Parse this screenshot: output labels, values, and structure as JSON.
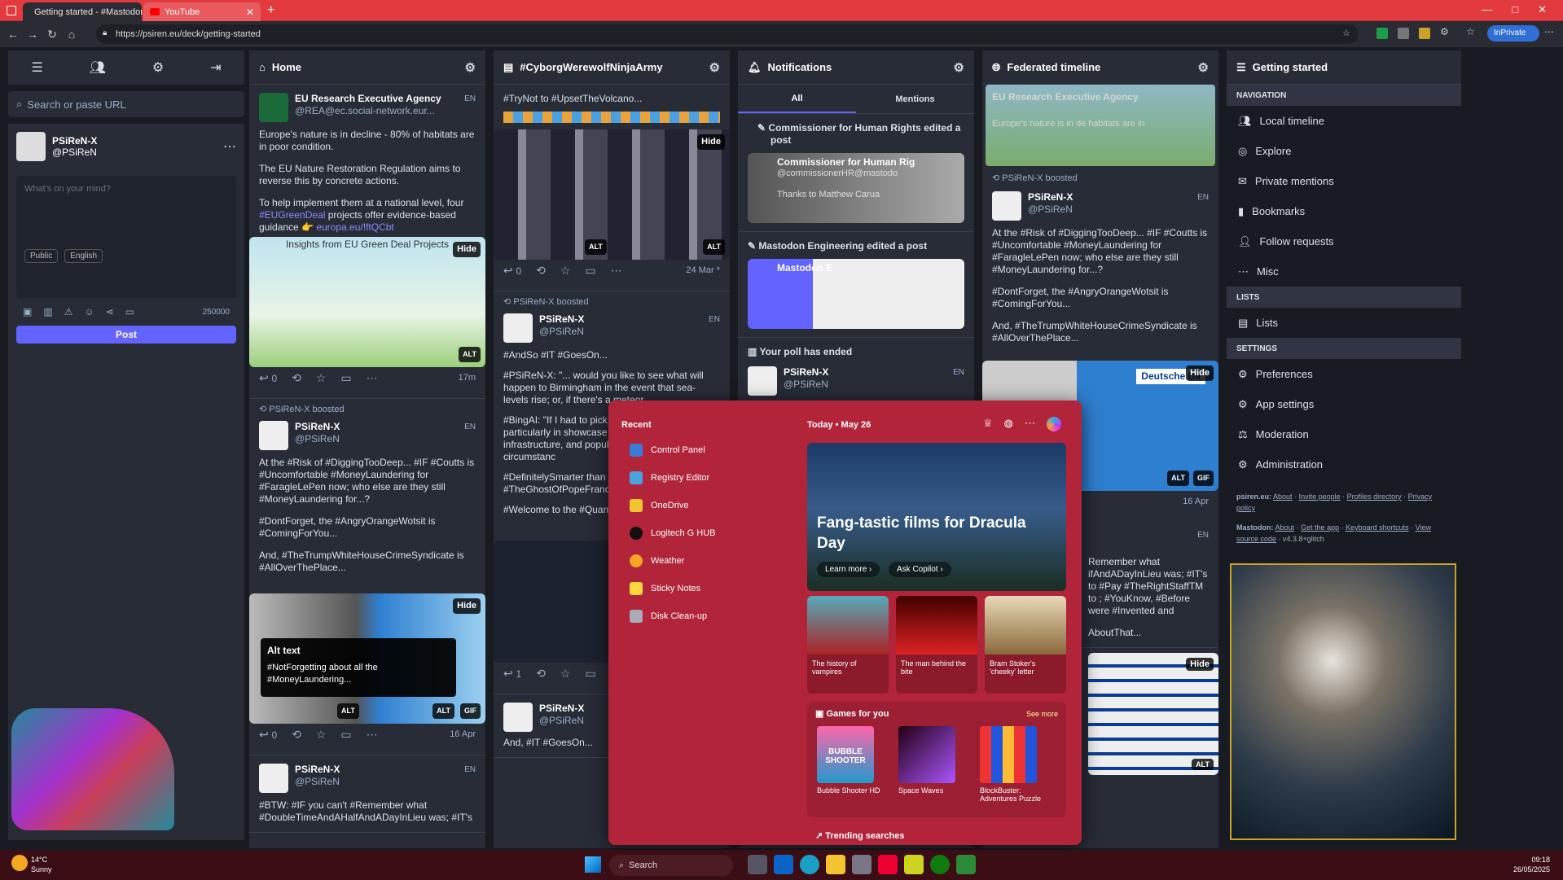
{
  "browser": {
    "tabs": [
      {
        "label": "Getting started - #MastodonSpyR...",
        "close": "✕"
      },
      {
        "label": "YouTube",
        "close": "✕"
      }
    ],
    "new_tab": "+",
    "url": "https://psiren.eu/deck/getting-started",
    "inprivate": "InPrivate"
  },
  "compose": {
    "search_placeholder": "Search or paste URL",
    "account_name": "PSiReN-X",
    "account_handle": "@PSiReN",
    "textarea_placeholder": "What's on your mind?",
    "visibility": "Public",
    "language": "English",
    "char_count": "250000",
    "post_button": "Post"
  },
  "home": {
    "title": "Home",
    "post1": {
      "name": "EU Research Executive Agency",
      "handle": "@REA@ec.social-network.eur...",
      "lang": "EN",
      "p1": "Europe's nature is in decline - 80% of habitats are in poor condition.",
      "p2": "The EU Nature Restoration Regulation aims to reverse this by concrete actions.",
      "p3a": "To help implement them at a national level, four ",
      "p3tag": "#EUGreenDeal",
      "p3b": " projects offer evidence-based guidance 👉 ",
      "p3link": "europa.eu/!ftQCbt",
      "img_caption": "Insights from EU Green Deal Projects",
      "hide": "Hide",
      "alt": "ALT",
      "replies": "0",
      "time": "17m"
    },
    "boost1": {
      "by": "PSiReN-X",
      "label": "boosted"
    },
    "post2": {
      "name": "PSiReN-X",
      "handle": "@PSiReN",
      "lang": "EN",
      "t1": "At the #Risk of #DiggingTooDeep... #IF #Coutts is #Uncomfortable #MoneyLaundering for #FaragleLePen now; who else are they still #MoneyLaundering for...?",
      "t2": "#DontForget, the #AngryOrangeWotsit is #ComingForYou...",
      "t3": "And, #TheTrumpWhiteHouseCrimeSyndicate is #AllOverThePlace...",
      "alt_title": "Alt text",
      "alt_body": "#NotForgetting about all the #MoneyLaundering...",
      "hide": "Hide",
      "alt": "ALT",
      "gif": "GIF",
      "replies": "0",
      "time": "16 Apr"
    },
    "post3": {
      "name": "PSiReN-X",
      "handle": "@PSiReN",
      "lang": "EN",
      "t1": "#BTW: #IF you can't #Remember what #DoubleTimeAndAHalfAndADayInLieu was; #IT's"
    }
  },
  "cyborg": {
    "title": "#CyborgWerewolfNinjaArmy",
    "top": "#TryNot to #UpsetTheVolcano...",
    "hide": "Hide",
    "alt": "ALT",
    "replies": "0",
    "time": "24 Mar *",
    "boost": {
      "by": "PSiReN-X",
      "label": "boosted"
    },
    "post": {
      "name": "PSiReN-X",
      "handle": "@PSiReN",
      "lang": "EN",
      "t1": "#AndSo #IT #GoesOn...",
      "t2": "#PSiReN-X: \"... would you like to see what will happen to Birmingham in the event that sea-levels rise; or, if there's a meteor",
      "t3": "#BingAI: \"If I had to pick, t might unveil particularly in showcase cascading effec infrastructure, and popula extraordinary circumstanc",
      "t4": "#DefinitelySmarter than b #TheGhostOfPopeFrancis",
      "t5": "#Welcome to the #QuantumHighlyWeaponi"
    },
    "replies2": "1",
    "post2": {
      "name": "PSiReN-X",
      "handle": "@PSiReN",
      "t1": "And, #IT #GoesOn..."
    }
  },
  "notifications": {
    "title": "Notifications",
    "tab_all": "All",
    "tab_mentions": "Mentions",
    "n1": "Commissioner for Human Rights edited a post",
    "n1_name": "Commissioner for Human Rig",
    "n1_handle": "@commissionerHR@mastodo",
    "n1_text": "Thanks to Matthew Carua",
    "n2": "Mastodon Engineering edited a post",
    "n2_img": "Mastodon E",
    "n3": "Your poll has ended",
    "n3_name": "PSiReN-X",
    "n3_handle": "@PSiReN",
    "n3_lang": "EN"
  },
  "federated": {
    "title": "Federated timeline",
    "ghost_name": "EU Research Executive Agency",
    "ghost_text": "Europe's nature is in de habitats are in",
    "boost": {
      "by": "PSiReN-X",
      "label": "boosted"
    },
    "post": {
      "name": "PSiReN-X",
      "handle": "@PSiReN",
      "lang": "EN",
      "t1": "At the #Risk of #DiggingTooDeep... #IF #Coutts is #Uncomfortable #MoneyLaundering for #FaragleLePen now; who else are they still #MoneyLaundering for...?",
      "t2": "#DontForget, the #AngryOrangeWotsit is #ComingForYou...",
      "t3": "And, #TheTrumpWhiteHouseCrimeSyndicate is #AllOverThePlace..."
    },
    "img_label": "Deutsche Ba",
    "hide": "Hide",
    "alt": "ALT",
    "gif": "GIF",
    "time": "16 Apr",
    "post2": {
      "lang": "EN",
      "t1": "Remember what ifAndADayInLieu was; #IT's to #Pay #TheRightStaffTM to ; #YouKnow, #Before were #Invented and",
      "t2": "AboutThat..."
    },
    "hide2": "Hide",
    "alt2": "ALT"
  },
  "getting_started": {
    "title": "Getting started",
    "nav_heading": "NAVIGATION",
    "nav": [
      "Local timeline",
      "Explore",
      "Private mentions",
      "Bookmarks",
      "Follow requests",
      "Misc"
    ],
    "lists_heading": "LISTS",
    "lists": [
      "Lists"
    ],
    "settings_heading": "SETTINGS",
    "settings": [
      "Preferences",
      "App settings",
      "Moderation",
      "Administration"
    ],
    "footer1_site": "psiren.eu:",
    "footer1_links": [
      "About",
      "Invite people",
      "Profiles directory",
      "Privacy policy"
    ],
    "footer2_site": "Mastodon:",
    "footer2_links": [
      "About",
      "Get the app",
      "Keyboard shortcuts",
      "View source code"
    ],
    "version": "v4.3.8+glitch"
  },
  "start_menu": {
    "recent_heading": "Recent",
    "recent": [
      "Control Panel",
      "Registry Editor",
      "OneDrive",
      "Logitech G HUB",
      "Weather",
      "Sticky Notes",
      "Disk Clean-up"
    ],
    "today": "Today",
    "date": "May 26",
    "hero_title": "Fang-tastic films for Dracula Day",
    "learn_more": "Learn more",
    "ask_copilot": "Ask Copilot",
    "cards": [
      "The history of vampires",
      "The man behind the bite",
      "Bram Stoker's 'cheeky' letter"
    ],
    "games_heading": "Games for you",
    "see_more": "See more",
    "games": [
      "Bubble Shooter HD",
      "Space Waves",
      "BlockBuster: Adventures Puzzle"
    ],
    "game_logo": "BUBBLE SHOOTER",
    "trending": "Trending searches"
  },
  "taskbar": {
    "temp": "14°C",
    "weather": "Sunny",
    "search": "Search",
    "time": "09:18",
    "date": "26/05/2025"
  }
}
